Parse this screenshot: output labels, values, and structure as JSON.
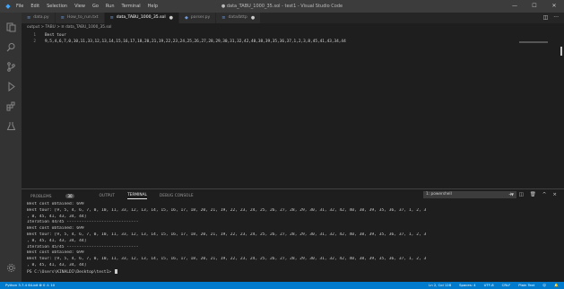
{
  "title_bar": {
    "menu": [
      "File",
      "Edit",
      "Selection",
      "View",
      "Go",
      "Run",
      "Terminal",
      "Help"
    ],
    "window_title": "● data_TABU_1000_35.sol - test1 - Visual Studio Code",
    "minimize": "—",
    "maximize": "☐",
    "close": "✕"
  },
  "tabs": [
    {
      "label": "data.py",
      "icon": "python-file-icon",
      "modified": false
    },
    {
      "label": "How_to_run.txt",
      "icon": "text-file-icon",
      "modified": false
    },
    {
      "label": "data_TABU_1000_35.sol",
      "icon": "text-file-icon",
      "modified": true,
      "active": true
    },
    {
      "label": "parser.py",
      "icon": "python-file-icon",
      "modified": false
    },
    {
      "label": "data/bttp",
      "icon": "text-file-icon",
      "modified": true
    }
  ],
  "tab_tools": {
    "split": "◫",
    "more": "···"
  },
  "breadcrumb": "output > TABU > ≡ data_TABU_1000_35.sol",
  "editor_lines": [
    {
      "num": "1",
      "text": "Best tour"
    },
    {
      "num": "2",
      "text": "9,5,4,6,7,0,10,11,33,12,13,14,15,16,17,18,20,21,19,22,23,24,25,26,27,28,29,30,31,32,42,40,38,39,35,36,37,1,2,3,8,45,41,43,34,44"
    }
  ],
  "panel": {
    "tabs": [
      "PROBLEMS",
      "OUTPUT",
      "TERMINAL",
      "DEBUG CONSOLE"
    ],
    "problems_count": "30",
    "active_tab": "TERMINAL",
    "shell": "1: powershell",
    "tools": [
      "+",
      "◫",
      "🗑",
      "^",
      "×"
    ]
  },
  "terminal_lines": [
    "Best cost obtained:  699",
    "Best tour: [9, 5, 4, 6, 7, 0, 10, 11, 33, 12, 13, 14, 15, 16, 17, 18, 20, 21, 19, 22, 23, 24, 25, 26, 27, 28, 29, 30, 31, 32, 42, 40, 38, 39, 35, 36, 37, 1, 2, 3",
    ", 8, 45, 41, 43, 34, 44]",
    "Iteration 44/45 -----------------------------",
    "Best cost obtained:  699",
    "Best tour: [9, 5, 4, 6, 7, 0, 10, 11, 33, 12, 13, 14, 15, 16, 17, 18, 20, 21, 19, 22, 23, 24, 25, 26, 27, 28, 29, 30, 31, 32, 42, 40, 38, 39, 35, 36, 37, 1, 2, 3",
    ", 8, 45, 41, 43, 34, 44]",
    "Iteration 45/45 -----------------------------",
    "Best cost obtained:  699",
    "Best tour: [9, 5, 4, 6, 7, 0, 10, 11, 33, 12, 13, 14, 15, 16, 17, 18, 20, 21, 19, 22, 23, 24, 25, 26, 27, 28, 29, 30, 31, 32, 42, 40, 38, 39, 35, 36, 37, 1, 2, 3",
    ", 8, 45, 41, 43, 34, 44]"
  ],
  "prompt": "PS C:\\Users\\KINALDI\\Desktop\\test1> ",
  "status": {
    "left": "Python 3.7.4 64-bit   ⊗ 0 ⚠ 10",
    "right": [
      "Ln 2, Col 128",
      "Spaces: 4",
      "UTF-8",
      "CRLF",
      "Plain Text",
      "☺",
      "🔔"
    ]
  },
  "colors": {
    "status_bar": "#007acc",
    "editor_bg": "#1e1e1e",
    "activity_bar": "#333333"
  }
}
